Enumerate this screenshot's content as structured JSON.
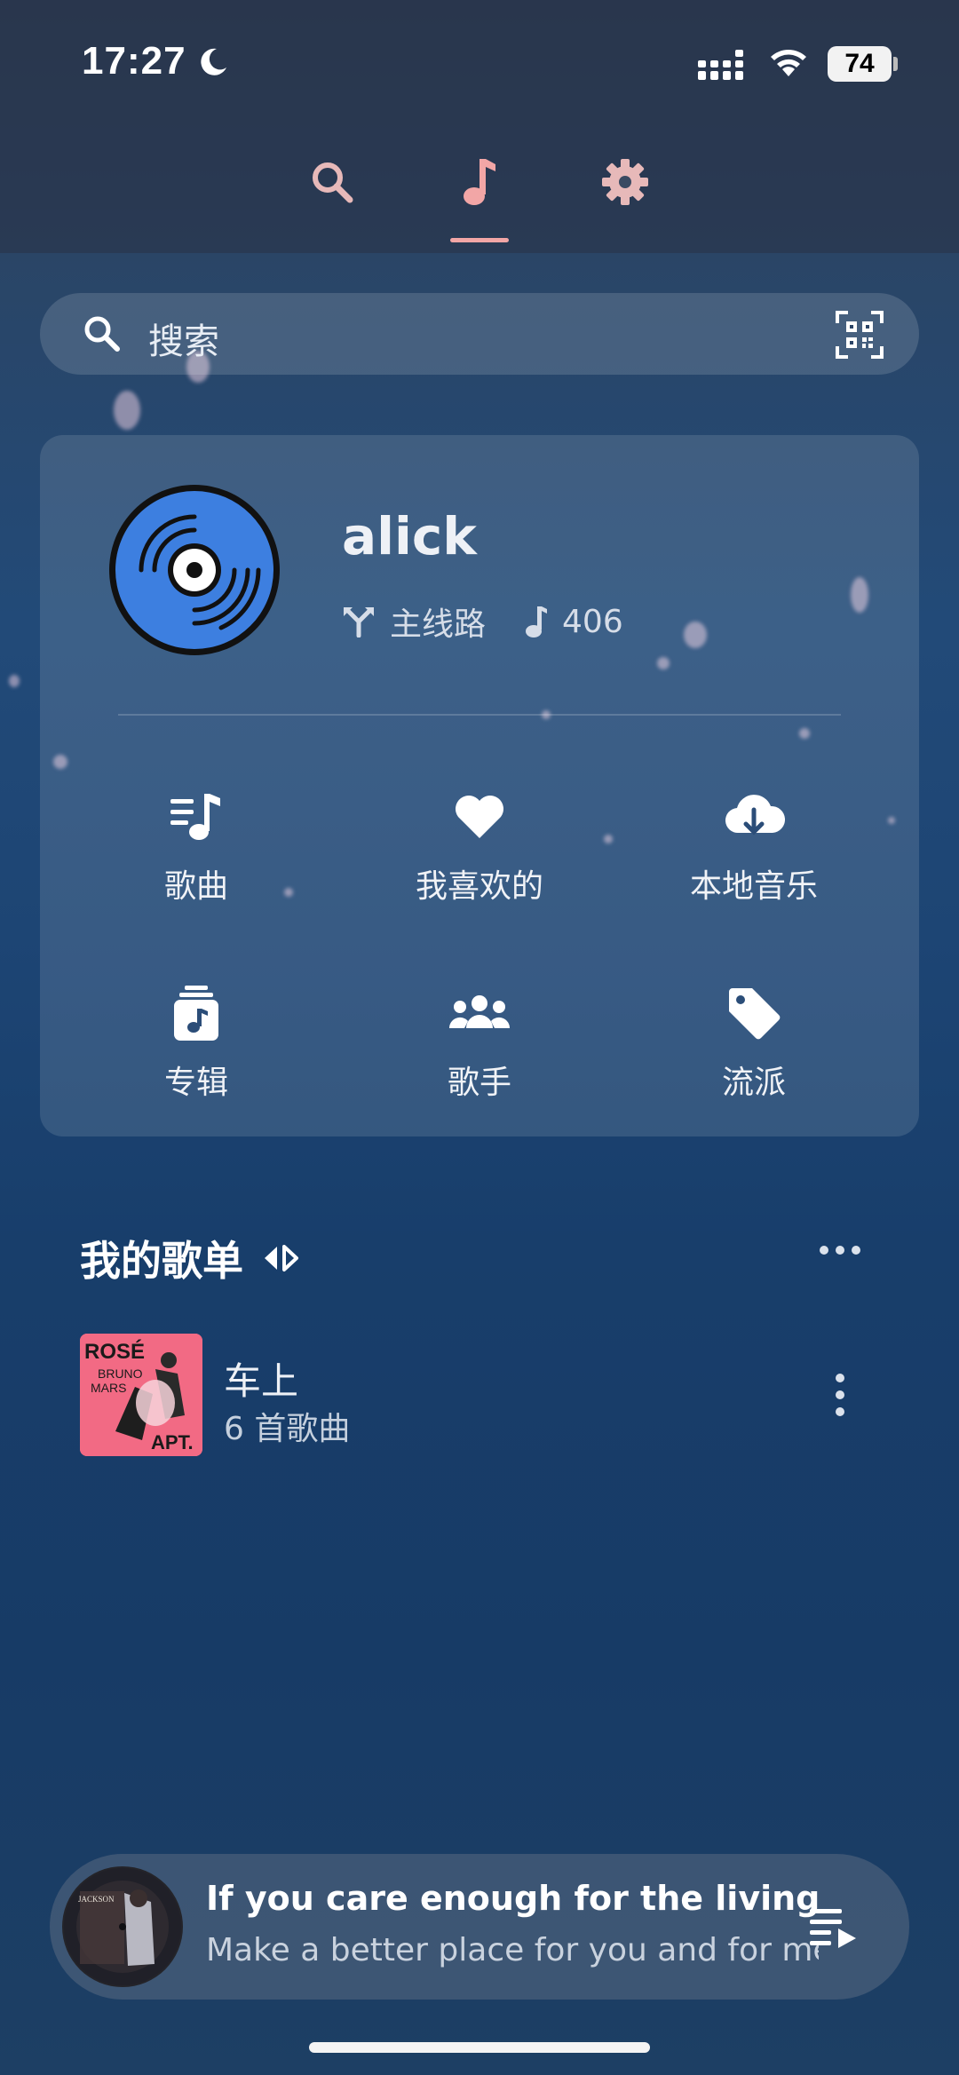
{
  "status_bar": {
    "time": "17:27",
    "battery": "74"
  },
  "tabs": [
    {
      "name": "search-tab",
      "icon": "search-icon"
    },
    {
      "name": "music-tab",
      "icon": "music-note-icon",
      "active": true
    },
    {
      "name": "settings-tab",
      "icon": "gear-icon"
    }
  ],
  "search": {
    "placeholder": "搜索"
  },
  "profile": {
    "username": "alick",
    "route_label": "主线路",
    "song_count": "406"
  },
  "library": {
    "songs": "歌曲",
    "favorites": "我喜欢的",
    "local_music": "本地音乐",
    "albums": "专辑",
    "artists": "歌手",
    "genres": "流派"
  },
  "playlists_section": {
    "title": "我的歌单",
    "items": [
      {
        "name": "车上",
        "count": "6 首歌曲",
        "cover_text": [
          "ROSÉ",
          "BRUNO",
          "MARS",
          "APT."
        ]
      }
    ]
  },
  "now_playing": {
    "title": "If you care enough for the living",
    "subtitle": "Make a better place for you and for me",
    "cover_text": "JACKSON"
  },
  "colors": {
    "accent": "#f2a6a6",
    "avatar_blue": "#3d7fe0",
    "playlist_cover": "#f26a84"
  }
}
